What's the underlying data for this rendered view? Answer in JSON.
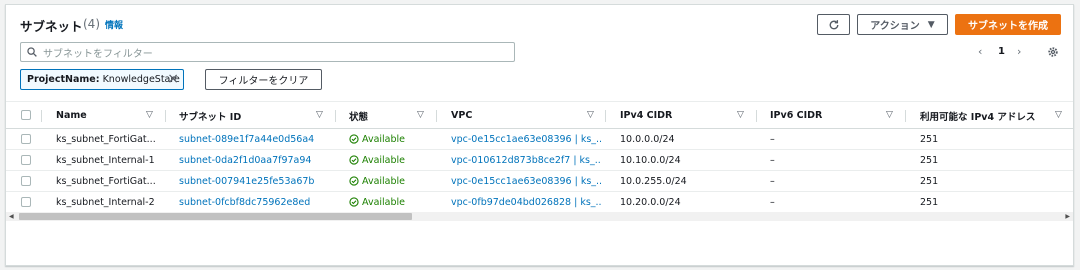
{
  "header": {
    "title": "サブネット",
    "count": "(4)",
    "info_label": "情報"
  },
  "toolbar": {
    "refresh_icon": "refresh-icon",
    "actions_label": "アクション",
    "create_label": "サブネットを作成"
  },
  "search": {
    "placeholder": "サブネットをフィルター"
  },
  "pagination": {
    "current_page": "1"
  },
  "filter_token": {
    "key": "ProjectName:",
    "value": "KnowledgeStare"
  },
  "clear_filters_label": "フィルターをクリア",
  "columns": [
    "Name",
    "サブネット ID",
    "状態",
    "VPC",
    "IPv4 CIDR",
    "IPv6 CIDR",
    "利用可能な IPv4 アドレス"
  ],
  "rows": [
    {
      "name": "ks_subnet_FortiGat...",
      "subnet_id": "subnet-089e1f7a44e0d56a4",
      "state": "Available",
      "vpc": "vpc-0e15cc1ae63e08396 | ks_...",
      "ipv4": "10.0.0.0/24",
      "ipv6": "–",
      "available_ips": "251"
    },
    {
      "name": "ks_subnet_Internal-1",
      "subnet_id": "subnet-0da2f1d0aa7f97a94",
      "state": "Available",
      "vpc": "vpc-010612d873b8ce2f7 | ks_...",
      "ipv4": "10.10.0.0/24",
      "ipv6": "–",
      "available_ips": "251"
    },
    {
      "name": "ks_subnet_FortiGat...",
      "subnet_id": "subnet-007941e25fe53a67b",
      "state": "Available",
      "vpc": "vpc-0e15cc1ae63e08396 | ks_...",
      "ipv4": "10.0.255.0/24",
      "ipv6": "–",
      "available_ips": "251"
    },
    {
      "name": "ks_subnet_Internal-2",
      "subnet_id": "subnet-0fcbf8dc75962e8ed",
      "state": "Available",
      "vpc": "vpc-0fb97de04bd026828 | ks_...",
      "ipv4": "10.20.0.0/24",
      "ipv6": "–",
      "available_ips": "251"
    }
  ],
  "colors": {
    "primary": "#ec7211",
    "link": "#0073bb",
    "success": "#1d8102"
  }
}
